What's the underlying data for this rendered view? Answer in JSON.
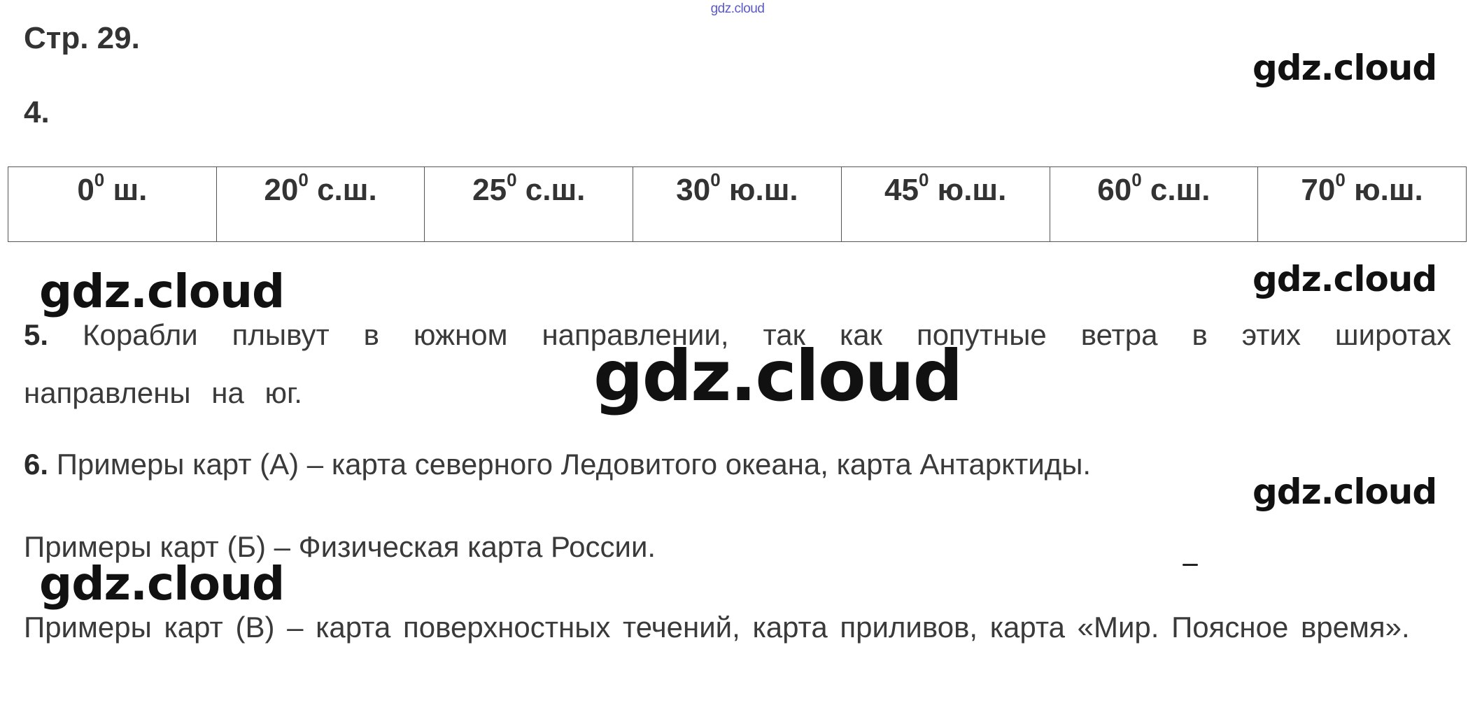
{
  "header_mark": "gdz.cloud",
  "page_ref": "Стр. 29.",
  "task4": {
    "number": "4.",
    "latitudes": [
      {
        "deg": "0",
        "sup": "0",
        "suffix": " ш."
      },
      {
        "deg": "20",
        "sup": "0",
        "suffix": " с.ш."
      },
      {
        "deg": "25",
        "sup": "0",
        "suffix": " с.ш."
      },
      {
        "deg": "30",
        "sup": "0",
        "suffix": " ю.ш."
      },
      {
        "deg": "45",
        "sup": "0",
        "suffix": " ю.ш."
      },
      {
        "deg": "60",
        "sup": "0",
        "suffix": " с.ш."
      },
      {
        "deg": "70",
        "sup": "0",
        "suffix": " ю.ш."
      }
    ]
  },
  "task5": {
    "number": "5.",
    "text": " Корабли плывут в южном направлении, так как попутные ветра в этих широтах направлены на юг."
  },
  "task6": {
    "number": "6.",
    "line_a": " Примеры карт (А) – карта северного Ледовитого океана, карта Антарктиды.",
    "line_b": "Примеры карт (Б) – Физическая карта России.",
    "line_v": "Примеры карт (В) – карта поверхностных течений, карта приливов, карта «Мир. Поясное время»."
  },
  "watermarks": [
    "gdz.cloud",
    "gdz.cloud",
    "gdz.cloud",
    "gdz.cloud",
    "gdz.cloud",
    "gdz.cloud"
  ]
}
